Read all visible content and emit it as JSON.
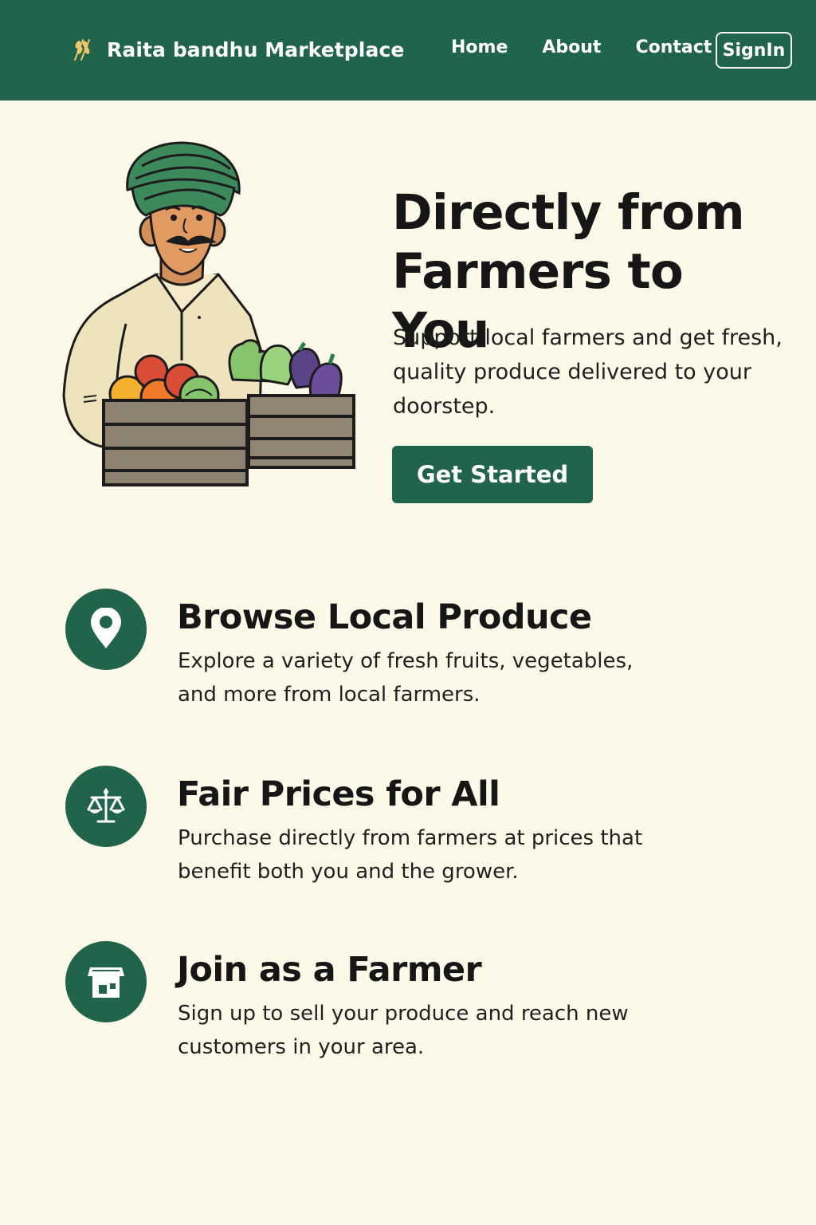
{
  "header": {
    "brand_name": "Raita bandhu Marketplace",
    "brand_icon": "wheat-icon",
    "nav_items": [
      {
        "label": "Home"
      },
      {
        "label": "About"
      },
      {
        "label": "Contact"
      }
    ],
    "signin_label": "SignIn"
  },
  "hero": {
    "title": "Directly from Farmers to You",
    "subtitle": "Support local farmers and get fresh, quality produce delivered to your doorstep.",
    "cta_label": "Get Started"
  },
  "features": [
    {
      "title": "Browse Local Produce",
      "description": "Explore a variety of fresh fruits, vegetables, and more from local farmers.",
      "icon": "location-pin-icon"
    },
    {
      "title": "Fair Prices for All",
      "description": "Purchase directly from farmers at prices that benefit both you and the grower.",
      "icon": "balance-scale-icon"
    },
    {
      "title": "Join as a Farmer",
      "description": "Sign up to sell your produce and reach new customers in your area.",
      "icon": "farm-shop-icon"
    }
  ],
  "colors": {
    "primary": "#20644b",
    "background": "#fdf9e9",
    "text": "#161616"
  }
}
